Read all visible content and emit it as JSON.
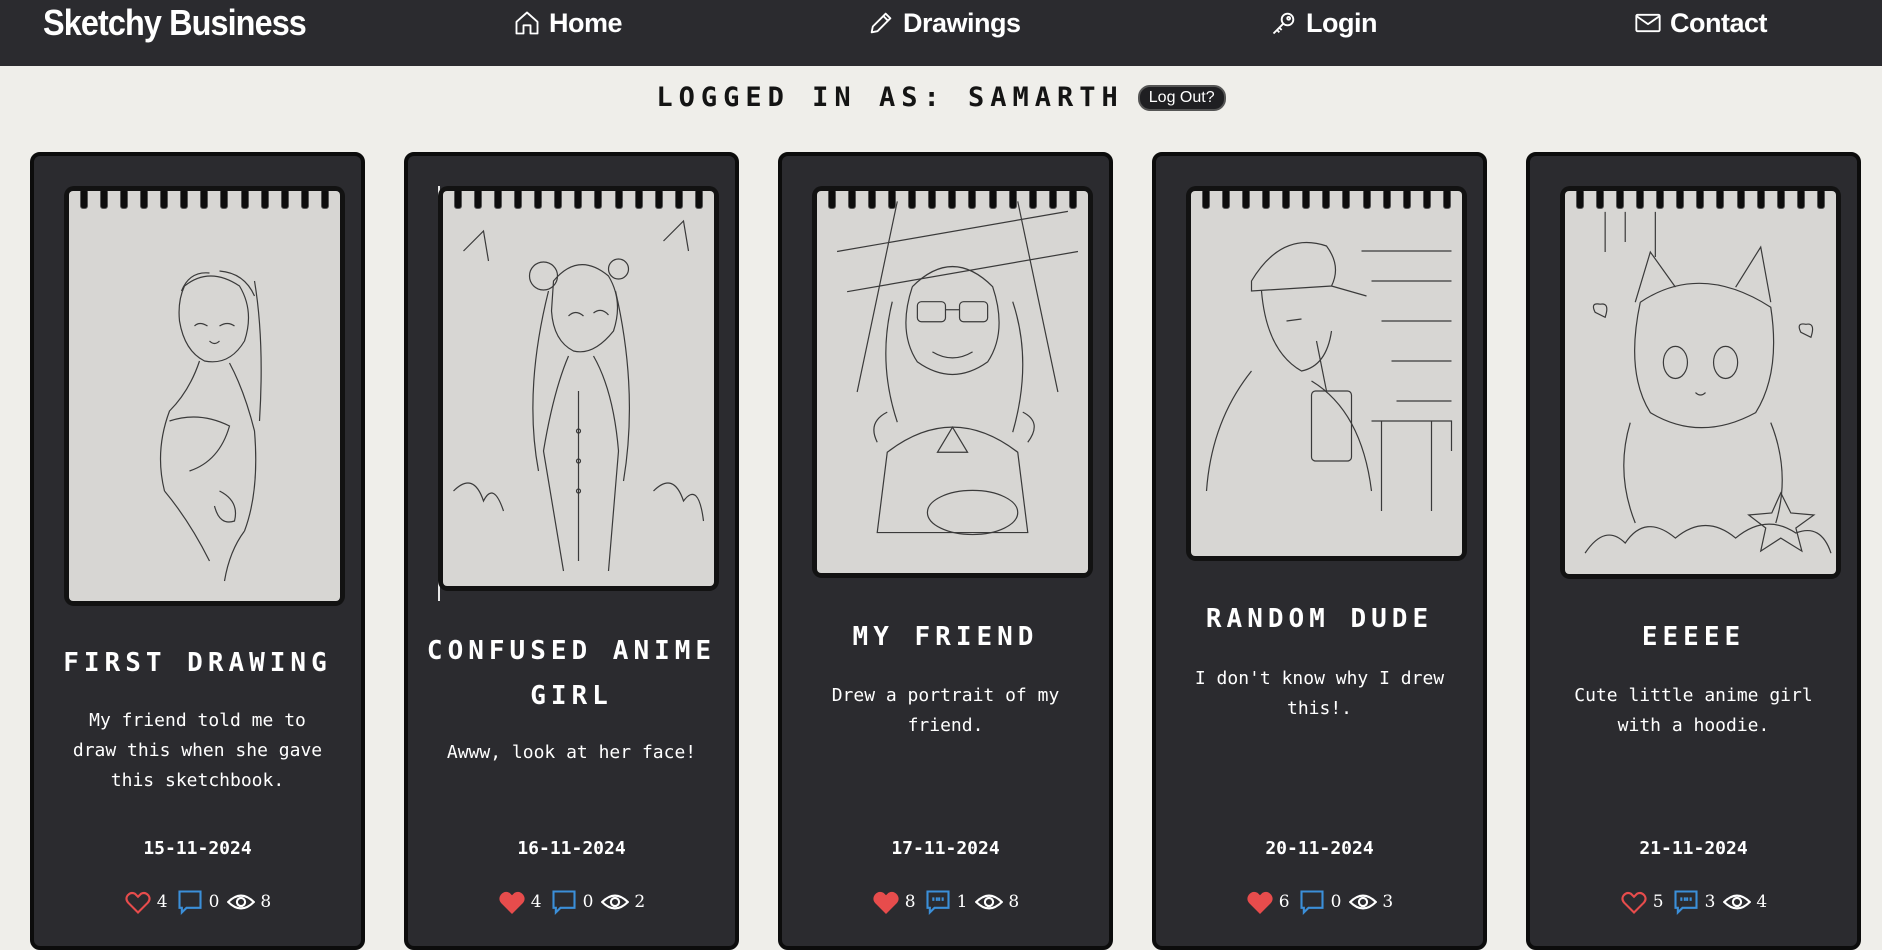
{
  "nav": {
    "brand": "Sketchy Business",
    "home": "Home",
    "drawings": "Drawings",
    "login": "Login",
    "contact": "Contact"
  },
  "status": {
    "logged_in_text": "LOGGED IN AS: SAMARTH",
    "logout_label": "Log Out?"
  },
  "cards": [
    {
      "title": "FIRST DRAWING",
      "description": "My friend told me to draw this when she gave this sketchbook.",
      "date": "15-11-2024",
      "likes": "4",
      "comments": "0",
      "views": "8",
      "liked": false,
      "commented": false
    },
    {
      "title": "CONFUSED ANIME GIRL",
      "description": "Awww, look at her face!",
      "date": "16-11-2024",
      "likes": "4",
      "comments": "0",
      "views": "2",
      "liked": true,
      "commented": false
    },
    {
      "title": "MY FRIEND",
      "description": "Drew a portrait of my friend.",
      "date": "17-11-2024",
      "likes": "8",
      "comments": "1",
      "views": "8",
      "liked": true,
      "commented": true
    },
    {
      "title": "RANDOM DUDE",
      "description": "I don't know why I drew this!.",
      "date": "20-11-2024",
      "likes": "6",
      "comments": "0",
      "views": "3",
      "liked": true,
      "commented": false
    },
    {
      "title": "EEEEE",
      "description": "Cute little anime girl with a hoodie.",
      "date": "21-11-2024",
      "likes": "5",
      "comments": "3",
      "views": "4",
      "liked": false,
      "commented": true
    }
  ],
  "colors": {
    "nav_bg": "#2b2b2f",
    "page_bg": "#efeeea",
    "card_bg": "#2b2b2f",
    "like": "#e74c4c",
    "comment": "#3b8fd9"
  }
}
